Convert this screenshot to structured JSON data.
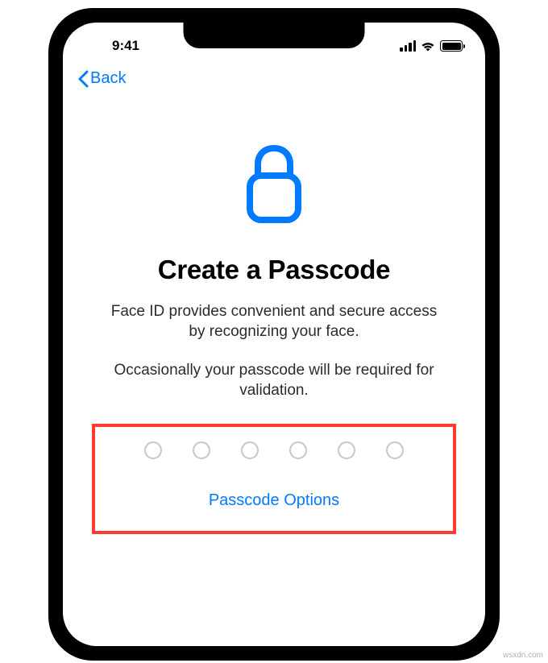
{
  "status": {
    "time": "9:41"
  },
  "nav": {
    "back_label": "Back"
  },
  "content": {
    "title": "Create a Passcode",
    "subtitle1": "Face ID provides convenient and secure access by recognizing your face.",
    "subtitle2": "Occasionally your passcode will be required for validation.",
    "options_label": "Passcode Options",
    "passcode_length": 6
  },
  "watermark": "wsxdn.com"
}
